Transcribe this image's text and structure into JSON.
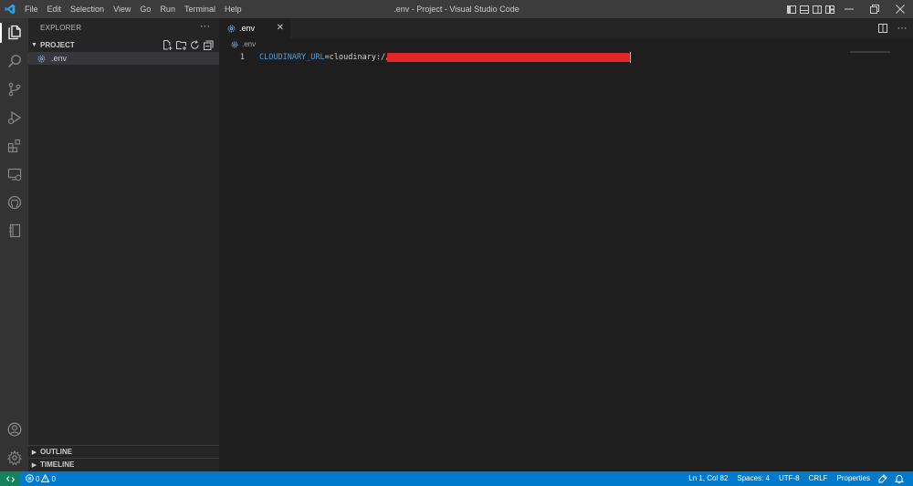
{
  "window": {
    "title": ".env - Project - Visual Studio Code"
  },
  "menu": [
    "File",
    "Edit",
    "Selection",
    "View",
    "Go",
    "Run",
    "Terminal",
    "Help"
  ],
  "activity_bar": {
    "top": [
      "files-icon",
      "search-icon",
      "source-control-icon",
      "run-debug-icon",
      "extensions-icon",
      "remote-explorer-icon",
      "github-icon",
      "notebook-icon"
    ],
    "bottom": [
      "account-icon",
      "manage-gear-icon"
    ]
  },
  "sidebar": {
    "header": "EXPLORER",
    "more": "···",
    "project_section": "PROJECT",
    "files": [
      {
        "name": ".env",
        "icon": "gear-icon"
      }
    ],
    "outline_section": "OUTLINE",
    "timeline_section": "TIMELINE"
  },
  "editor": {
    "tabs": [
      {
        "label": ".env",
        "active": true,
        "close": "✕"
      }
    ],
    "breadcrumb": ".env",
    "lines": [
      {
        "number": "1",
        "key": "CLOUDINARY_URL",
        "eq": "=",
        "value": "cloudinary://"
      }
    ],
    "redacted_color": "#e3262a"
  },
  "statusbar": {
    "errors": "0",
    "warnings": "0",
    "position": "Ln 1, Col 82",
    "spaces": "Spaces: 4",
    "encoding": "UTF-8",
    "eol": "CRLF",
    "language": "Properties"
  },
  "colors": {
    "accent": "#007acc",
    "remote": "#16825d",
    "titlebar": "#3c3c3c",
    "activitybar": "#333333",
    "sidebar": "#252526",
    "editor": "#1e1e1e"
  }
}
